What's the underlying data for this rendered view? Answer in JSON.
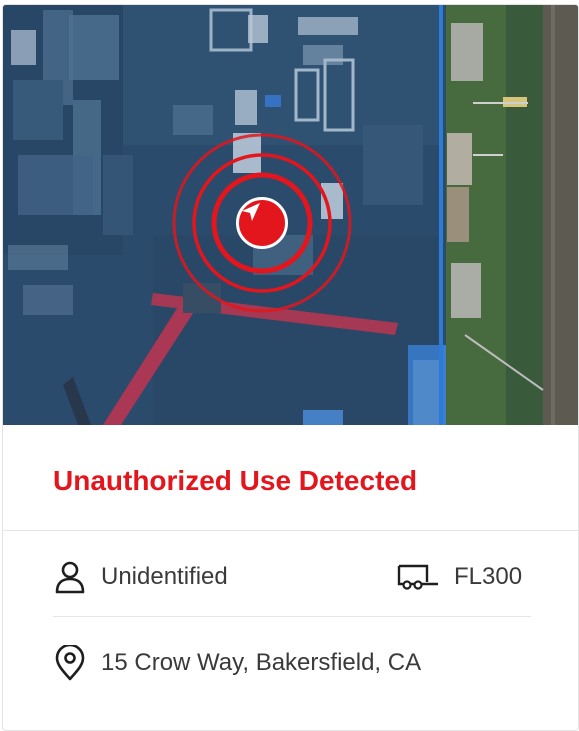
{
  "alert": {
    "title": "Unauthorized Use Detected",
    "accent_color": "#e2161c"
  },
  "details": {
    "operator": {
      "icon": "person-icon",
      "label": "Unidentified"
    },
    "equipment": {
      "icon": "truck-icon",
      "label": "FL300"
    },
    "location": {
      "icon": "location-pin-icon",
      "label": "15 Crow Way, Bakersfield, CA"
    }
  },
  "map": {
    "marker_icon": "navigation-arrow-icon",
    "pulse_color": "#e2161c",
    "boundary_color": "#2f86ea"
  }
}
